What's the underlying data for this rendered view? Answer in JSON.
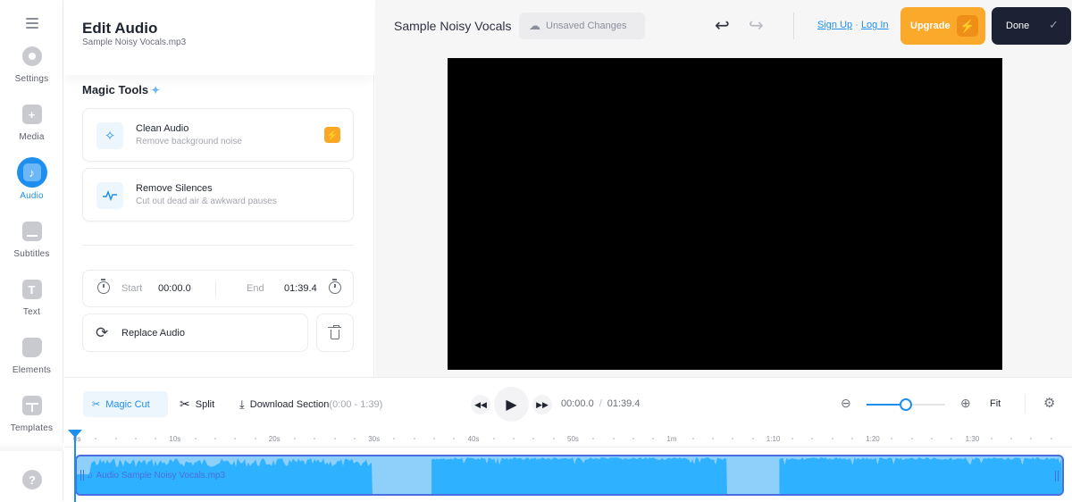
{
  "sidebar": {
    "items": [
      {
        "label": "Settings",
        "icon": "settings-icon",
        "active": false
      },
      {
        "label": "Media",
        "icon": "plus-icon",
        "active": false
      },
      {
        "label": "Audio",
        "icon": "music-note-icon",
        "active": true
      },
      {
        "label": "Subtitles",
        "icon": "subtitles-icon",
        "active": false
      },
      {
        "label": "Text",
        "icon": "text-icon",
        "active": false
      },
      {
        "label": "Elements",
        "icon": "sticker-icon",
        "active": false
      },
      {
        "label": "Templates",
        "icon": "layout-icon",
        "active": false
      }
    ],
    "help_glyph": "?"
  },
  "panel": {
    "title": "Edit Audio",
    "subtitle": "Sample Noisy Vocals.mp3",
    "magic_tools_title": "Magic Tools",
    "tools": [
      {
        "name": "Clean Audio",
        "desc": "Remove background noise",
        "premium": true
      },
      {
        "name": "Remove Silences",
        "desc": "Cut out dead air & awkward pauses",
        "premium": false
      }
    ],
    "start_label": "Start",
    "start_value": "00:00.0",
    "end_label": "End",
    "end_value": "01:39.4",
    "replace_label": "Replace Audio"
  },
  "header": {
    "project_title": "Sample Noisy Vocals",
    "save_status": "Unsaved Changes",
    "sign_up": "Sign Up",
    "separator": "·",
    "log_in": "Log In",
    "upgrade": "Upgrade",
    "done": "Done"
  },
  "timeline": {
    "magic_cut": "Magic Cut",
    "split": "Split",
    "download": "Download Section",
    "download_range": "(0:00 - 1:39)",
    "current_time": "00:00.0",
    "time_sep": "/",
    "total_time": "01:39.4",
    "fit": "Fit",
    "zoom_level": 0.5,
    "ruler_labels": [
      "0s",
      "10s",
      "20s",
      "30s",
      "40s",
      "50s",
      "1m",
      "1:10",
      "1:20",
      "1:30"
    ],
    "clip_label": "Audio Sample Noisy Vocals.mp3",
    "duration_seconds": 99.4,
    "playhead_seconds": 0
  },
  "colors": {
    "accent": "#1f8fef",
    "upgrade": "#fba92a",
    "done": "#1c2234",
    "clip_border": "#4a6ee0",
    "waveform": "#2eb1ff",
    "clip_bg": "#8fd0fb"
  }
}
